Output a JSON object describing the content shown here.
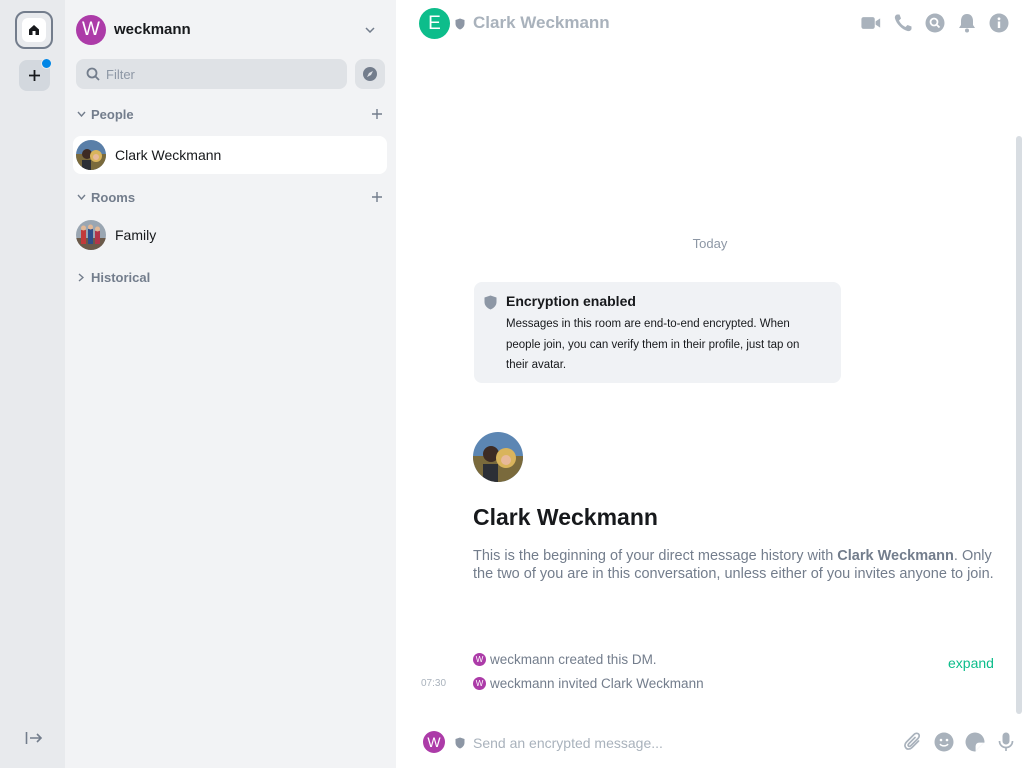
{
  "account": {
    "avatar_letter": "W",
    "display_name": "weckmann",
    "avatar_color": "#ac3ba8"
  },
  "search": {
    "placeholder": "Filter"
  },
  "sections": {
    "people": {
      "label": "People"
    },
    "rooms": {
      "label": "Rooms"
    },
    "historical": {
      "label": "Historical"
    }
  },
  "people": [
    {
      "name": "Clark Weckmann",
      "selected": true
    }
  ],
  "rooms": [
    {
      "name": "Family"
    }
  ],
  "room": {
    "avatar_letter": "E",
    "avatar_color": "#0dbd8b",
    "title": "Clark Weckmann"
  },
  "timeline": {
    "date_separator": "Today",
    "encryption": {
      "title": "Encryption enabled",
      "description": "Messages in this room are end-to-end encrypted. When people join, you can verify them in their profile, just tap on their avatar."
    },
    "intro": {
      "name": "Clark Weckmann",
      "text_before": "This is the beginning of your direct message history with ",
      "text_name": "Clark Weckmann",
      "text_after": ". Only the two of you are in this conversation, unless either of you invites anyone to join."
    },
    "events": [
      {
        "avatar_letter": "W",
        "text": "weckmann created this DM."
      },
      {
        "avatar_letter": "W",
        "text": "weckmann invited Clark Weckmann",
        "time": "07:30"
      }
    ],
    "expand_label": "expand"
  },
  "composer": {
    "avatar_letter": "W",
    "placeholder": "Send an encrypted message..."
  },
  "colors": {
    "accent": "#0dbd8b",
    "notification": "#0086e6",
    "muted": "#737d8c"
  }
}
